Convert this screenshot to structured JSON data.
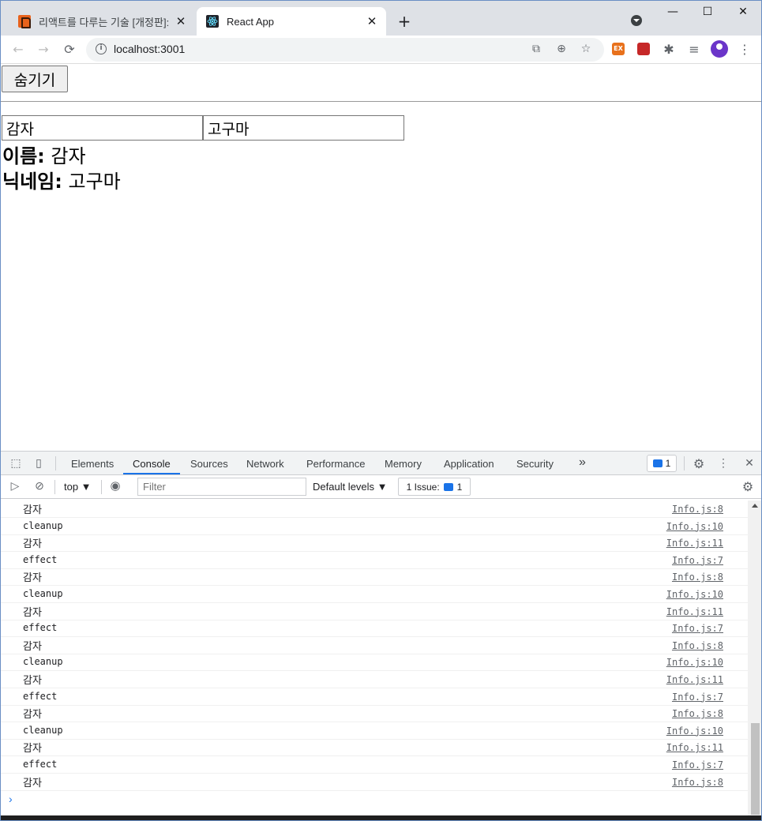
{
  "browser": {
    "tabs": [
      {
        "title": "리액트를 다루는 기술 [개정판]: 리",
        "active": false,
        "favicon": "book-icon"
      },
      {
        "title": "React App",
        "active": true,
        "favicon": "react-icon"
      }
    ],
    "new_tab": "+",
    "window_controls": {
      "minimize": "—",
      "maximize": "☐",
      "close": "✕"
    },
    "url": "localhost:3001",
    "extensions": [
      {
        "label": "EX",
        "color": "#e8711c"
      },
      {
        "label": "",
        "color": "#c62828"
      }
    ],
    "accent": "#1a73e8"
  },
  "page": {
    "hide_button": "숨기기",
    "name_input": "감자",
    "nickname_input": "고구마",
    "name_label": "이름:",
    "name_value": "감자",
    "nickname_label": "닉네임:",
    "nickname_value": "고구마"
  },
  "devtools": {
    "tabs": [
      "Elements",
      "Console",
      "Sources",
      "Network",
      "Performance",
      "Memory",
      "Application",
      "Security"
    ],
    "more": "»",
    "active_tab": "Console",
    "issues_count": "1",
    "context": "top ▼",
    "filter_placeholder": "Filter",
    "levels": "Default levels ▼",
    "issue_button": "1 Issue:",
    "issue_button_count": "1",
    "console_rows": [
      {
        "msg": "감자",
        "src": "Info.js:8"
      },
      {
        "msg": "cleanup",
        "src": "Info.js:10"
      },
      {
        "msg": "감자",
        "src": "Info.js:11"
      },
      {
        "msg": "effect",
        "src": "Info.js:7"
      },
      {
        "msg": "감자",
        "src": "Info.js:8"
      },
      {
        "msg": "cleanup",
        "src": "Info.js:10"
      },
      {
        "msg": "감자",
        "src": "Info.js:11"
      },
      {
        "msg": "effect",
        "src": "Info.js:7"
      },
      {
        "msg": "감자",
        "src": "Info.js:8"
      },
      {
        "msg": "cleanup",
        "src": "Info.js:10"
      },
      {
        "msg": "감자",
        "src": "Info.js:11"
      },
      {
        "msg": "effect",
        "src": "Info.js:7"
      },
      {
        "msg": "감자",
        "src": "Info.js:8"
      },
      {
        "msg": "cleanup",
        "src": "Info.js:10"
      },
      {
        "msg": "감자",
        "src": "Info.js:11"
      },
      {
        "msg": "effect",
        "src": "Info.js:7"
      },
      {
        "msg": "감자",
        "src": "Info.js:8"
      }
    ],
    "prompt": "›"
  }
}
